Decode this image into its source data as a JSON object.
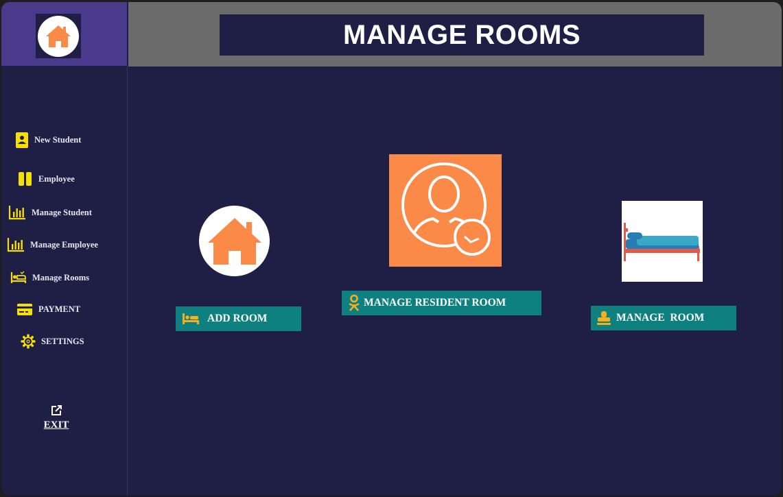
{
  "header": {
    "title": "MANAGE ROOMS"
  },
  "sidebar": {
    "logo_icon": "home-icon",
    "items": [
      {
        "label": "New Student",
        "icon": "id-card-icon"
      },
      {
        "label": "Employee",
        "icon": "pause-icon"
      },
      {
        "label": "Manage Student",
        "icon": "bar-chart-icon"
      },
      {
        "label": "Manage Employee",
        "icon": "bar-chart-icon"
      },
      {
        "label": "Manage Rooms",
        "icon": "bed-icon"
      },
      {
        "label": "PAYMENT",
        "icon": "credit-card-icon"
      },
      {
        "label": "SETTINGS",
        "icon": "gear-icon"
      }
    ],
    "exit_label": "EXIT",
    "exit_icon": "external-link-icon"
  },
  "actions": [
    {
      "label": "ADD ROOM",
      "icon": "bed-icon"
    },
    {
      "label": "MANAGE RESIDENT ROOM",
      "icon": "odnoklassniki-icon"
    },
    {
      "label": "MANAGE  ROOM",
      "icon": "stamp-icon"
    }
  ],
  "colors": {
    "background": "#1f1e45",
    "sidebar_head": "#4a3a8c",
    "header_bar": "#6b6b6b",
    "accent_orange": "#fb8a48",
    "button_teal": "#0e8080",
    "icon_yellow": "#f5e000"
  }
}
